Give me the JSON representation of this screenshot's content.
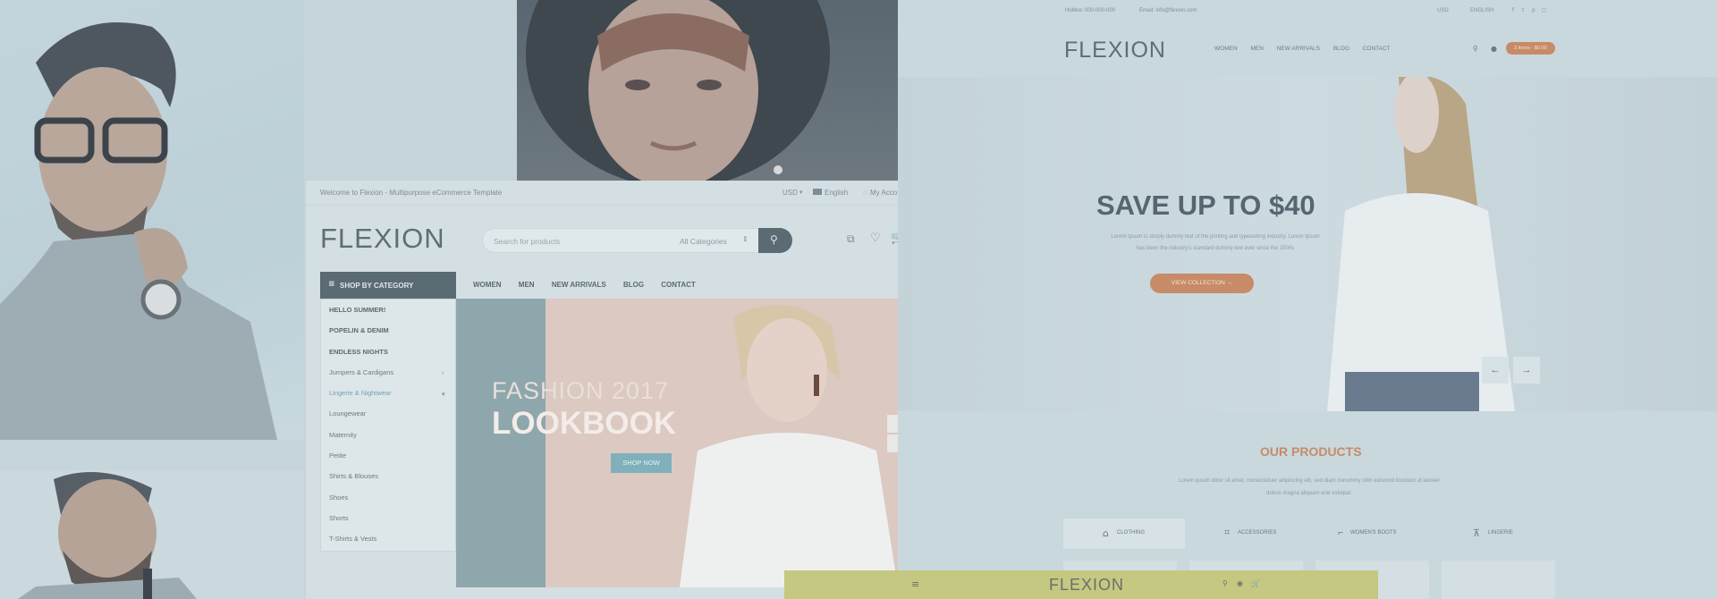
{
  "middle_store": {
    "topbar": {
      "welcome": "Welcome to Flexion - Multipurpose eCommerce Template",
      "currency": "USD",
      "language": "English",
      "account": "My Acco"
    },
    "logo": "FLEXION",
    "search": {
      "placeholder": "Search for products",
      "category": "All Categories"
    },
    "shop_by_category": "SHOP BY CATEGORY",
    "categories": [
      {
        "label": "HELLO SUMMER!"
      },
      {
        "label": "POPELIN & DENIM"
      },
      {
        "label": "ENDLESS NIGHTS"
      },
      {
        "label": "Jumpers & Cardigans"
      },
      {
        "label": "Lingerie & Nightwear"
      },
      {
        "label": "Loungewear"
      },
      {
        "label": "Maternity"
      },
      {
        "label": "Petite"
      },
      {
        "label": "Shirts & Blouses"
      },
      {
        "label": "Shoes"
      },
      {
        "label": "Shorts"
      },
      {
        "label": "T-Shirts & Vests"
      }
    ],
    "nav": [
      "WOMEN",
      "MEN",
      "NEW ARRIVALS",
      "BLOG",
      "CONTACT"
    ],
    "hero": {
      "line1": "FASHION 2017",
      "line2": "LOOKBOOK",
      "button": "SHOP NOW"
    }
  },
  "right_store": {
    "topbar": {
      "hotline": "Hotline: 000-000-000",
      "email": "Email: info@flexion.com",
      "currency": "USD",
      "language": "ENGLISH"
    },
    "logo": "FLEXION",
    "nav": [
      "WOMEN",
      "MEN",
      "NEW ARRIVALS",
      "BLOG",
      "CONTACT"
    ],
    "cart": "2 items - $0.00",
    "hero": {
      "title": "SAVE UP TO $40",
      "text1": "Lorem Ipsum is simply dummy text of the printing and typesetting industry. Lorem Ipsum",
      "text2": "has been the industry's standard dummy text ever since the 1500s",
      "button": "VIEW COLLECTION →"
    },
    "products": {
      "title": "OUR PRODUCTS",
      "text1": "Lorem ipsum dolor sit amet, consectetuer adipiscing elit, sed diam nonummy nibh euismod tincidunt ut laoreet",
      "text2": "dolore magna aliquam erat volutpat.",
      "tabs": [
        "CLOTHING",
        "ACCESSORIES",
        "WOMEN'S BOOTS",
        "LINGERIE"
      ]
    }
  },
  "bottom_bar": {
    "logo": "FLEXION"
  },
  "colors": {
    "accent": "#c78b67",
    "dark": "#5b6b73",
    "teal": "#7fb0bb"
  }
}
